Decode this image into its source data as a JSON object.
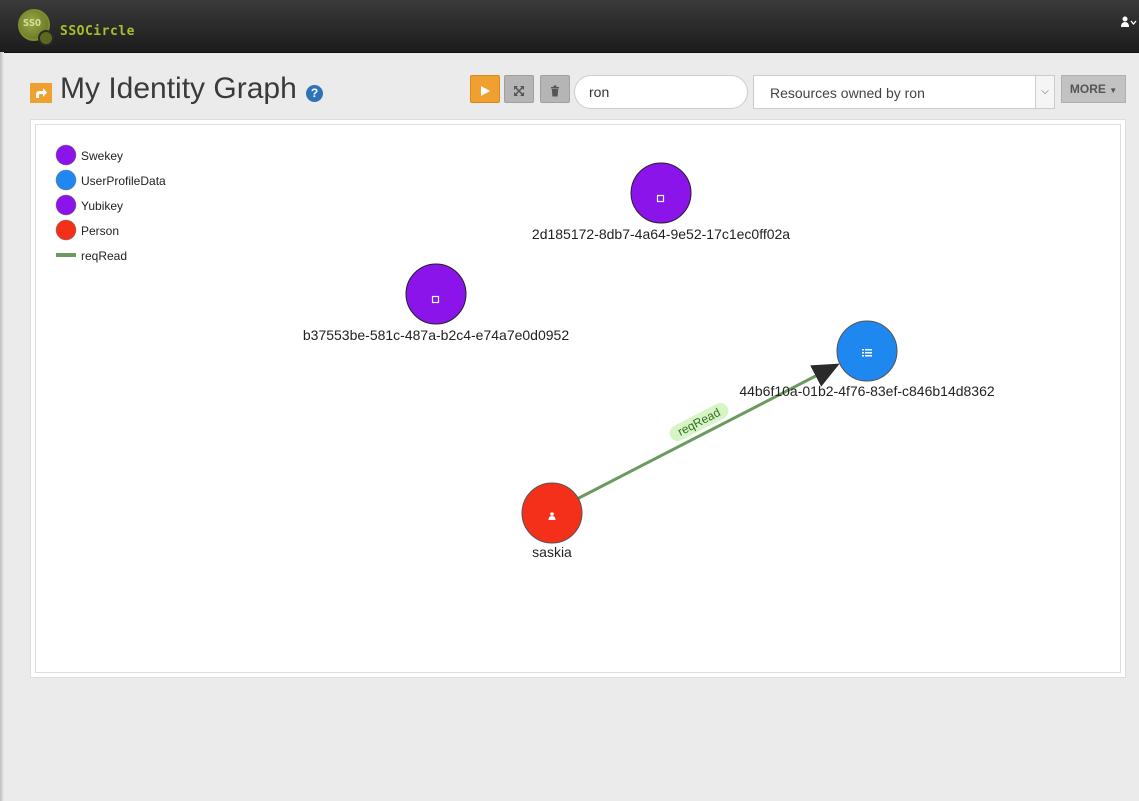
{
  "app": {
    "logo_sso": "SSO",
    "logo_text": "SSOCircle",
    "user_icon": "user-icon",
    "user_menu_caret": "chevron-down-icon"
  },
  "header": {
    "title": "My Identity Graph",
    "share_icon": "share-icon",
    "help_icon": "question-icon",
    "help_glyph": "?"
  },
  "toolbar": {
    "play_icon": "play-icon",
    "expand_icon": "expand-icon",
    "delete_icon": "trash-icon",
    "search_value": "ron",
    "query_selected": "Resources owned by ron",
    "more_label": "MORE"
  },
  "legend": [
    {
      "label": "Swekey",
      "color": "#8B14EA",
      "kind": "node"
    },
    {
      "label": "UserProfileData",
      "color": "#1E88F0",
      "kind": "node"
    },
    {
      "label": "Yubikey",
      "color": "#8B14EA",
      "kind": "node"
    },
    {
      "label": "Person",
      "color": "#F5301A",
      "kind": "node"
    },
    {
      "label": "reqRead",
      "color": "#6A9A5E",
      "kind": "edge"
    }
  ],
  "nodes": [
    {
      "id": "n1",
      "label": "2d185172-8db7-4a64-9e52-17c1ec0ff02a",
      "type": "Swekey",
      "color": "#8B14EA",
      "icon": "device-icon"
    },
    {
      "id": "n2",
      "label": "b37553be-581c-487a-b2c4-e74a7e0d0952",
      "type": "Yubikey",
      "color": "#8B14EA",
      "icon": "device-icon"
    },
    {
      "id": "n3",
      "label": "44b6f10a-01b2-4f76-83ef-c846b14d8362",
      "type": "UserProfileData",
      "color": "#1E88F0",
      "icon": "list-icon"
    },
    {
      "id": "n4",
      "label": "saskia",
      "type": "Person",
      "color": "#F5301A",
      "icon": "person-icon"
    }
  ],
  "edges": [
    {
      "from": "n4",
      "to": "n3",
      "label": "reqRead",
      "color": "#6A9A5E"
    }
  ]
}
